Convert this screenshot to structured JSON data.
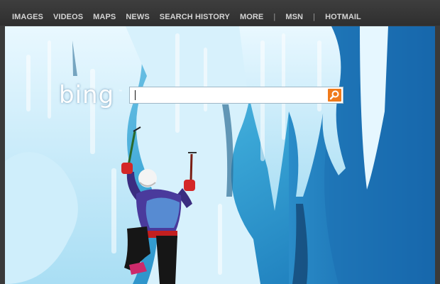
{
  "nav": {
    "items": [
      "IMAGES",
      "VIDEOS",
      "MAPS",
      "NEWS",
      "SEARCH HISTORY",
      "MORE"
    ],
    "separator": "|",
    "msn": "MSN",
    "hotmail": "HOTMAIL"
  },
  "logo": {
    "text": "bing",
    "mark": "™"
  },
  "search": {
    "value": "",
    "placeholder": "",
    "button_icon": "search-icon"
  },
  "background": {
    "subject": "ice-climber-photo"
  },
  "colors": {
    "accent": "#f07a1a",
    "nav_bg": "#333333",
    "nav_text": "#d4d4d4"
  }
}
